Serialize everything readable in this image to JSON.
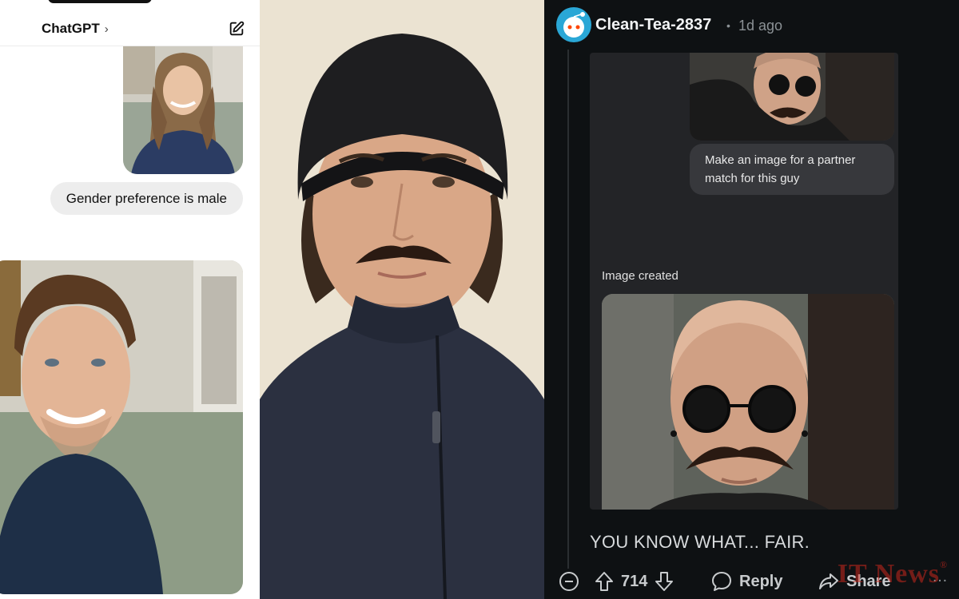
{
  "chatgpt": {
    "title": "ChatGPT",
    "title_chevron": "›",
    "user_message": "Gender preference is male",
    "icons": {
      "compose": "compose-icon"
    }
  },
  "reddit": {
    "username": "Clean-Tea-2837",
    "separator": "•",
    "time_ago": "1d ago",
    "embedded_chat": {
      "user_message": "Make an image for a partner match for this guy",
      "status": "Image created"
    },
    "comment_text": "YOU KNOW WHAT... FAIR.",
    "actions": {
      "vote_count": "714",
      "reply_label": "Reply",
      "share_label": "Share",
      "more_label": "…"
    },
    "icons": {
      "collapse": "collapse-minus-icon",
      "upvote": "upvote-arrow-icon",
      "downvote": "downvote-arrow-icon",
      "reply": "reply-bubble-icon",
      "share": "share-arrow-icon"
    }
  },
  "watermark": {
    "text": "IT News",
    "mark": "®"
  }
}
